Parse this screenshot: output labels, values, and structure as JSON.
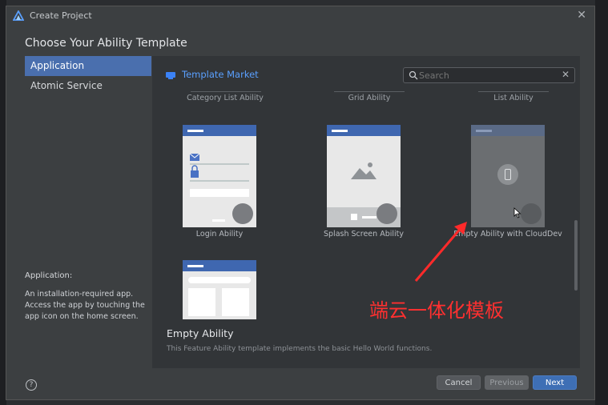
{
  "window": {
    "title": "Create Project"
  },
  "heading": "Choose Your Ability Template",
  "sidebar": {
    "items": [
      {
        "label": "Application",
        "active": true
      },
      {
        "label": "Atomic Service",
        "active": false
      }
    ]
  },
  "description": {
    "title": "Application:",
    "body": "An installation-required app. Access the app by touching the app icon on the home screen."
  },
  "market": {
    "label": "Template Market"
  },
  "search": {
    "value": "",
    "placeholder": "Search"
  },
  "top_row": [
    "Category List Ability",
    "Grid Ability",
    "List Ability"
  ],
  "templates": [
    {
      "label": "Login Ability"
    },
    {
      "label": "Splash Screen Ability"
    },
    {
      "label": "Empty Ability with CloudDev"
    },
    {
      "label": ""
    }
  ],
  "detail": {
    "title": "Empty Ability",
    "description": "This Feature Ability template implements the basic Hello World functions."
  },
  "annotation": "端云一体化模板",
  "footer": {
    "cancel": "Cancel",
    "previous": "Previous",
    "next": "Next",
    "help": "?"
  },
  "colors": {
    "accent": "#4a6fae",
    "primary_button": "#3e6fb5",
    "annotation": "#ff3030",
    "link": "#5aa0ff"
  }
}
